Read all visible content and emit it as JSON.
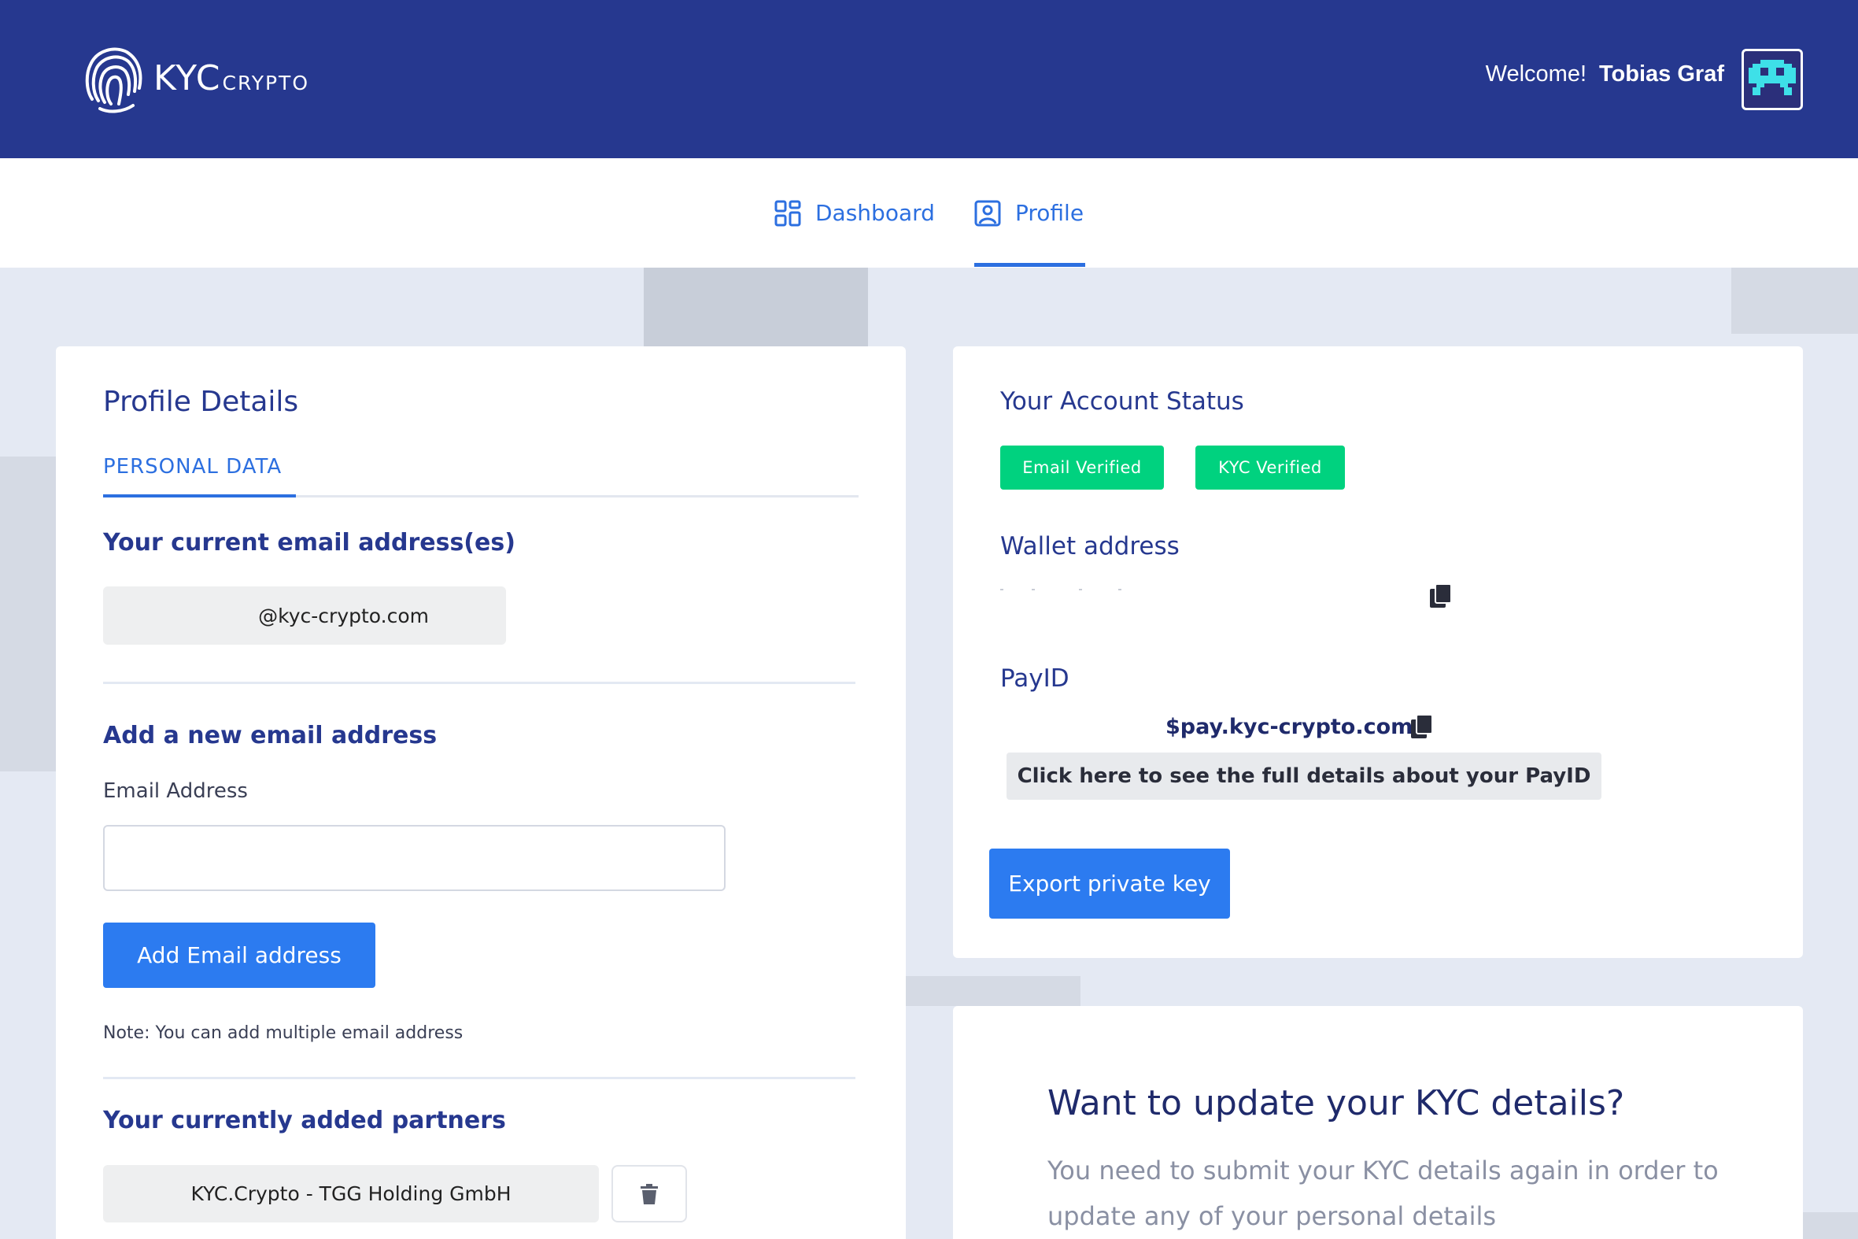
{
  "header": {
    "logo_main": "KYC",
    "logo_sub": "CRYPTO",
    "welcome": "Welcome!",
    "user_name": "Tobias Graf"
  },
  "nav": {
    "dashboard": "Dashboard",
    "profile": "Profile",
    "active": "Profile"
  },
  "profile": {
    "title": "Profile Details",
    "tab": "PERSONAL DATA",
    "current_email_heading": "Your current email address(es)",
    "current_email": "@kyc-crypto.com",
    "add_email_heading": "Add a new email address",
    "email_label": "Email Address",
    "email_value": "",
    "email_placeholder": "",
    "add_button": "Add Email address",
    "note": "Note: You can add multiple email address",
    "partners_heading": "Your currently added partners",
    "partners": [
      "KYC.Crypto - TGG Holding GmbH"
    ]
  },
  "account": {
    "title": "Your Account Status",
    "badges": [
      "Email Verified",
      "KYC Verified"
    ],
    "wallet_label": "Wallet address",
    "payid_label": "PayID",
    "payid_value": "$pay.kyc-crypto.com",
    "payid_details_button": "Click here to see the full details about your PayID",
    "export_button": "Export private key"
  },
  "kyc_update": {
    "title": "Want to update your KYC details?",
    "text": "You need to submit your KYC details again in order to update any of your personal details"
  },
  "colors": {
    "header_bg": "#26388f",
    "accent": "#2c7bf0",
    "verified": "#00d27f",
    "page_bg": "#e4e9f3"
  }
}
